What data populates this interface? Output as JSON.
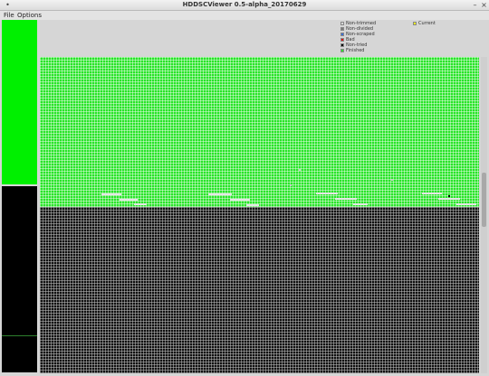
{
  "window": {
    "title": "HDDSCViewer 0.5-alpha_20170629",
    "left_button_icon": "•",
    "minimize_icon": "–",
    "close_icon": "×"
  },
  "menu": {
    "items": [
      "File",
      "Options"
    ]
  },
  "legend": {
    "items": [
      {
        "label": "Non-trimmed",
        "color": "#d8d8d8"
      },
      {
        "label": "Non-divided",
        "color": "#7a7a7a"
      },
      {
        "label": "Non-scraped",
        "color": "#3a6fd8"
      },
      {
        "label": "Bad",
        "color": "#e01010"
      },
      {
        "label": "Non-tried",
        "color": "#000000"
      },
      {
        "label": "Finished",
        "color": "#30e030"
      },
      {
        "label": "Current",
        "color": "#f0f020"
      }
    ]
  },
  "colors": {
    "finished": "#28e428",
    "non_tried": "#111111",
    "non_trimmed": "#e6e6e6"
  },
  "icons": [
    "window-menu-icon",
    "minimize-icon",
    "close-icon"
  ]
}
